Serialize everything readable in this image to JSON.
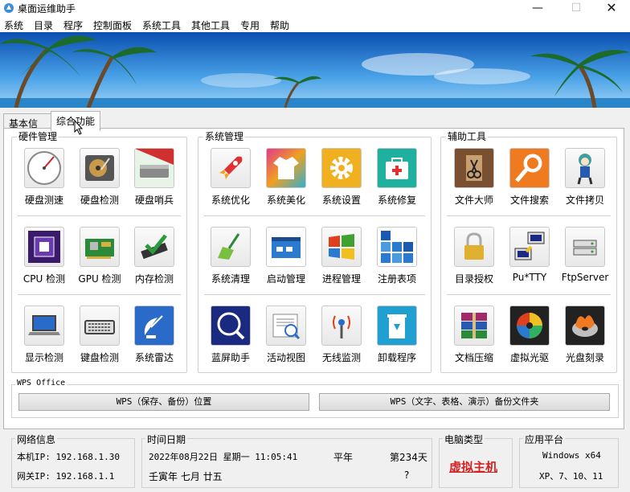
{
  "window": {
    "title": "桌面运维助手",
    "minimize": "—",
    "maximize": "☐",
    "close": "✕"
  },
  "menu": [
    "系统",
    "目录",
    "程序",
    "控制面板",
    "系统工具",
    "其他工具",
    "专用",
    "帮助"
  ],
  "tabs": [
    {
      "label": "基本信息",
      "active": false
    },
    {
      "label": "综合功能",
      "active": true
    }
  ],
  "groups": {
    "hardware": {
      "title": "硬件管理",
      "tools": [
        {
          "label": "硬盘测速",
          "icon": "gauge-icon"
        },
        {
          "label": "硬盘检测",
          "icon": "hdd-icon"
        },
        {
          "label": "硬盘哨兵",
          "icon": "drive-sentinel-icon"
        },
        {
          "label": "CPU 检测",
          "icon": "cpu-icon"
        },
        {
          "label": "GPU 检测",
          "icon": "gpu-card-icon"
        },
        {
          "label": "内存检测",
          "icon": "memory-check-icon"
        },
        {
          "label": "显示检测",
          "icon": "laptop-icon"
        },
        {
          "label": "键盘检测",
          "icon": "keyboard-icon"
        },
        {
          "label": "系统雷达",
          "icon": "satellite-icon"
        }
      ]
    },
    "system": {
      "title": "系统管理",
      "tools": [
        {
          "label": "系统优化",
          "icon": "rocket-icon"
        },
        {
          "label": "系统美化",
          "icon": "tshirt-icon"
        },
        {
          "label": "系统设置",
          "icon": "gear-icon"
        },
        {
          "label": "系统修复",
          "icon": "first-aid-icon"
        },
        {
          "label": "系统清理",
          "icon": "broom-icon"
        },
        {
          "label": "启动管理",
          "icon": "startup-window-icon"
        },
        {
          "label": "进程管理",
          "icon": "process-windows-icon"
        },
        {
          "label": "注册表项",
          "icon": "registry-grid-icon"
        },
        {
          "label": "蓝屏助手",
          "icon": "bluescreen-search-icon"
        },
        {
          "label": "活动视图",
          "icon": "activity-view-icon"
        },
        {
          "label": "无线监测",
          "icon": "wireless-icon"
        },
        {
          "label": "卸载程序",
          "icon": "recycle-bin-icon"
        }
      ]
    },
    "aux": {
      "title": "辅助工具",
      "tools": [
        {
          "label": "文件大师",
          "icon": "scissors-file-icon"
        },
        {
          "label": "文件搜索",
          "icon": "magnifier-icon"
        },
        {
          "label": "文件拷贝",
          "icon": "anime-character-icon"
        },
        {
          "label": "目录授权",
          "icon": "lock-icon"
        },
        {
          "label": "Pu*TTY",
          "icon": "putty-icon"
        },
        {
          "label": "FtpServer",
          "icon": "ftp-server-icon"
        },
        {
          "label": "文档压缩",
          "icon": "archive-books-icon"
        },
        {
          "label": "虚拟光驱",
          "icon": "virtual-drive-icon"
        },
        {
          "label": "光盘刻录",
          "icon": "burn-disc-icon"
        }
      ]
    }
  },
  "wps": {
    "title": "WPS Office",
    "btn1": "WPS（保存、备份）位置",
    "btn2": "WPS（文字、表格、演示）备份文件夹"
  },
  "status": {
    "network": {
      "title": "网络信息",
      "local_ip": "本机IP: 192.168.1.30",
      "gateway_ip": "网关IP: 192.168.1.1"
    },
    "datetime": {
      "title": "时间日期",
      "datetime": "2022年08月22日 星期一 11:05:41",
      "year_type": "平年",
      "day_of_year": "第234天",
      "lunar": "壬寅年  七月  廿五",
      "question": "?"
    },
    "computer": {
      "title": "电脑类型",
      "value": "虚拟主机"
    },
    "platform": {
      "title": "应用平台",
      "line1": "Windows x64",
      "line2": "XP、7、10、11"
    }
  }
}
